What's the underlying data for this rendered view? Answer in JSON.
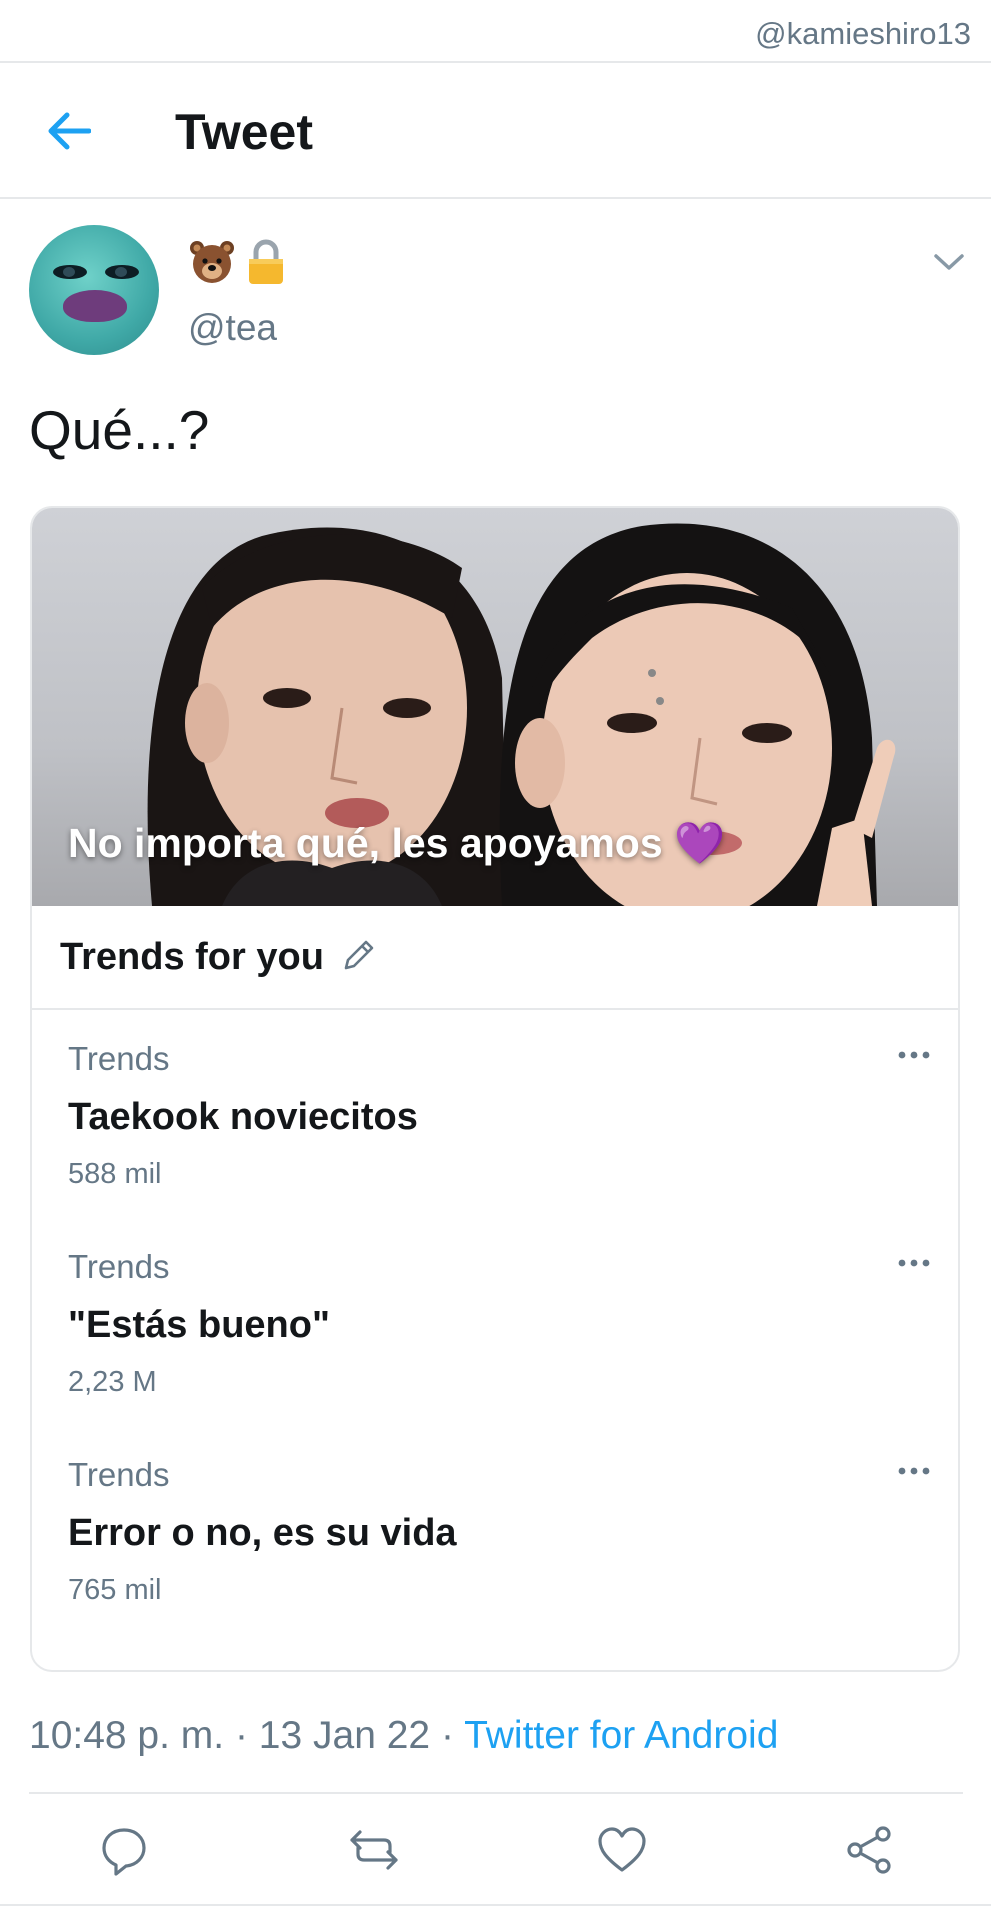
{
  "watermark": "@kamieshiro13",
  "header": {
    "title": "Tweet",
    "back_icon": "arrow-left-icon"
  },
  "tweet": {
    "display_name_emojis": [
      "🐻",
      "🔒"
    ],
    "handle": "@tea",
    "text": "Qué...?",
    "meta": {
      "time": "10:48 p. m.",
      "separator": " · ",
      "date": "13 Jan 22",
      "client": "Twitter for Android"
    }
  },
  "card": {
    "banner_text": "No importa qué, les apoyamos 💜",
    "trends_title": "Trends for you",
    "trends": [
      {
        "category": "Trends",
        "name": "Taekook noviecitos",
        "count": "588 mil"
      },
      {
        "category": "Trends",
        "name": "\"Estás bueno\"",
        "count": "2,23 M"
      },
      {
        "category": "Trends",
        "name": "Error o no, es su vida",
        "count": "765 mil"
      }
    ]
  },
  "actions": [
    "reply-icon",
    "retweet-icon",
    "like-icon",
    "share-icon"
  ],
  "colors": {
    "accent": "#1da1f2",
    "secondary_text": "#657786",
    "primary_text": "#14171a",
    "divider": "#e6e8ea"
  }
}
